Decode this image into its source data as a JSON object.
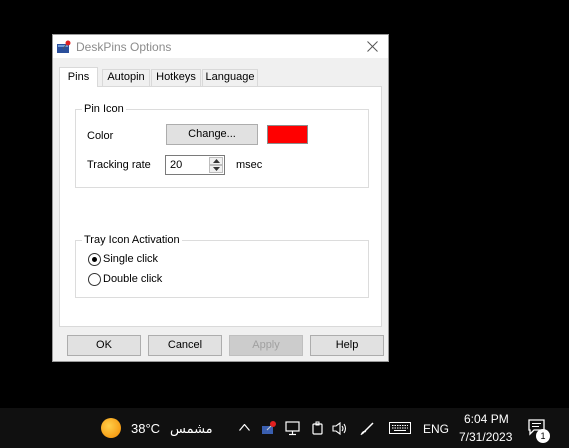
{
  "window": {
    "title": "DeskPins Options",
    "close_icon": "close-icon",
    "app_icon": "deskpins-app-icon"
  },
  "tabs": [
    {
      "label": "Pins",
      "active": true
    },
    {
      "label": "Autopin",
      "active": false
    },
    {
      "label": "Hotkeys",
      "active": false
    },
    {
      "label": "Language",
      "active": false
    }
  ],
  "pin_icon_group": {
    "legend": "Pin Icon",
    "color_label": "Color",
    "change_button": "Change...",
    "swatch_color": "#ff0000",
    "tracking_rate_label": "Tracking rate",
    "tracking_rate_value": "20",
    "tracking_rate_unit": "msec"
  },
  "tray_group": {
    "legend": "Tray Icon Activation",
    "options": [
      {
        "label": "Single click",
        "checked": true
      },
      {
        "label": "Double click",
        "checked": false
      }
    ]
  },
  "buttons": {
    "ok": "OK",
    "cancel": "Cancel",
    "apply": "Apply",
    "help": "Help"
  },
  "taskbar": {
    "temperature": "38°C",
    "weather_text": "مشمس",
    "language": "ENG",
    "time": "6:04 PM",
    "date": "7/31/2023",
    "notification_count": "1"
  }
}
